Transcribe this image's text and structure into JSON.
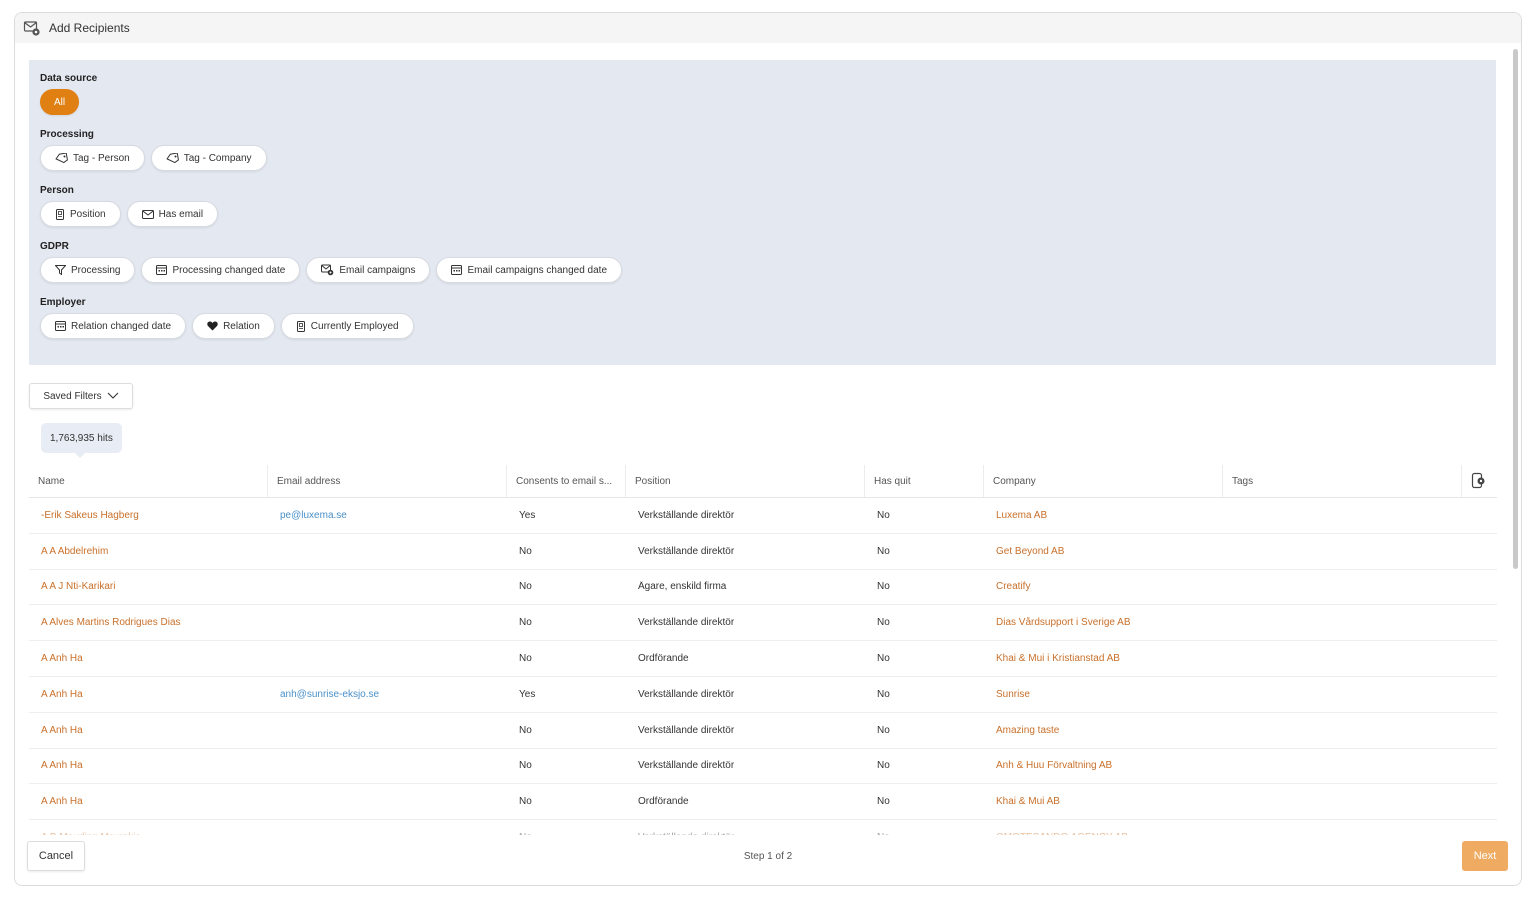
{
  "dialog": {
    "title": "Add Recipients"
  },
  "filters": {
    "data_source": {
      "label": "Data source",
      "chips": [
        "All"
      ]
    },
    "processing": {
      "label": "Processing",
      "chips": [
        "Tag - Person",
        "Tag - Company"
      ]
    },
    "person": {
      "label": "Person",
      "chips": [
        "Position",
        "Has email"
      ]
    },
    "gdpr": {
      "label": "GDPR",
      "chips": [
        "Processing",
        "Processing changed date",
        "Email campaigns",
        "Email campaigns changed date"
      ]
    },
    "employer": {
      "label": "Employer",
      "chips": [
        "Relation changed date",
        "Relation",
        "Currently Employed"
      ]
    }
  },
  "saved_filters": {
    "label": "Saved Filters"
  },
  "hits": {
    "label": "1,763,935 hits"
  },
  "table": {
    "columns": [
      "Name",
      "Email address",
      "Consents to email s...",
      "Position",
      "Has quit",
      "Company",
      "Tags"
    ],
    "rows": [
      [
        "-Erik Sakeus Hagberg",
        "pe@luxema.se",
        "Yes",
        "Verkställande direktör",
        "No",
        "Luxema AB"
      ],
      [
        "A A Abdelrehim",
        "",
        "No",
        "Verkställande direktör",
        "No",
        "Get Beyond AB"
      ],
      [
        "A A J Nti-Karikari",
        "",
        "No",
        "Ägare, enskild firma",
        "No",
        "Creatify"
      ],
      [
        "A Alves Martins Rodrigues Dias",
        "",
        "No",
        "Verkställande direktör",
        "No",
        "Dias Vårdsupport i Sverige AB"
      ],
      [
        "A Anh Ha",
        "",
        "No",
        "Ordförande",
        "No",
        "Khai & Mui i Kristianstad AB"
      ],
      [
        "A Anh Ha",
        "anh@sunrise-eksjo.se",
        "Yes",
        "Verkställande direktör",
        "No",
        "Sunrise"
      ],
      [
        "A Anh Ha",
        "",
        "No",
        "Verkställande direktör",
        "No",
        "Amazing taste"
      ],
      [
        "A Anh Ha",
        "",
        "No",
        "Verkställande direktör",
        "No",
        "Anh & Huu Förvaltning AB"
      ],
      [
        "A Anh Ha",
        "",
        "No",
        "Ordförande",
        "No",
        "Khai & Mui AB"
      ],
      [
        "A B Meurling Mavrakis",
        "",
        "No",
        "Verkställande direktör",
        "No",
        "OMOTESANDO AGENCY AB"
      ]
    ]
  },
  "footer": {
    "cancel": "Cancel",
    "step": "Step 1 of 2",
    "next": "Next"
  },
  "colors": {
    "accent": "#e07f12",
    "link_orange": "#c9702a",
    "link_blue": "#4a90c9",
    "filter_bg": "#e4e8f0"
  },
  "icons": {
    "title": "envelope-gear-icon",
    "tag": "tag-icon",
    "position": "badge-icon",
    "email": "envelope-icon",
    "filter": "funnel-icon",
    "calendar": "calendar-icon",
    "campaign": "envelope-gear-icon",
    "heart": "heart-icon",
    "chevron": "chevron-down-icon",
    "columns": "column-settings-icon"
  }
}
